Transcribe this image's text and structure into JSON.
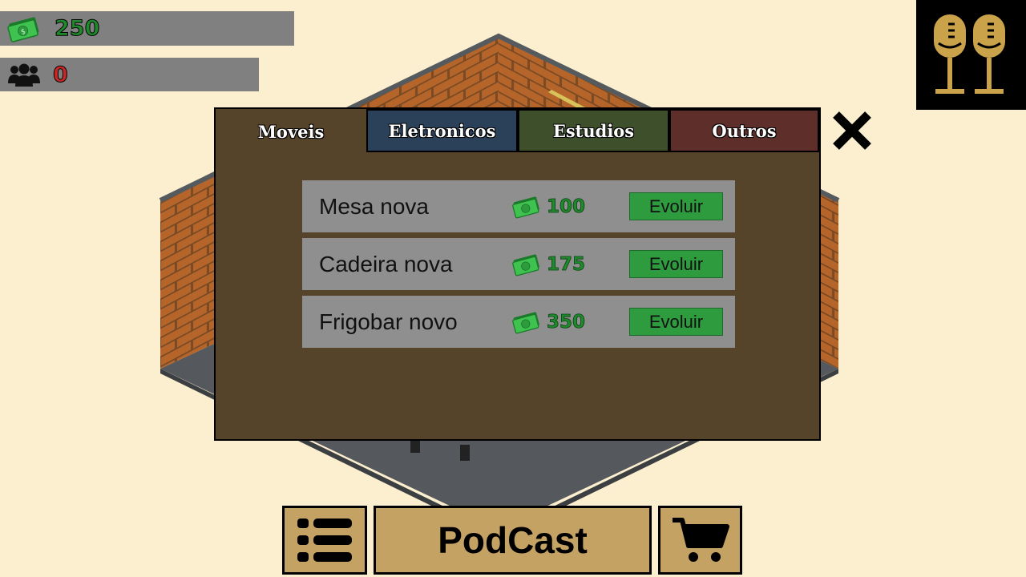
{
  "hud": {
    "money": "250",
    "listeners": "0"
  },
  "modal": {
    "tabs": [
      {
        "label": "Moveis",
        "color": "#55432a"
      },
      {
        "label": "Eletronicos",
        "color": "#2b4159"
      },
      {
        "label": "Estudios",
        "color": "#3e4f2c"
      },
      {
        "label": "Outros",
        "color": "#5e2e2a"
      }
    ],
    "items": [
      {
        "name": "Mesa nova",
        "price": "100",
        "button": "Evoluir"
      },
      {
        "name": "Cadeira nova",
        "price": "175",
        "button": "Evoluir"
      },
      {
        "name": "Frigobar novo",
        "price": "350",
        "button": "Evoluir"
      }
    ]
  },
  "bottom": {
    "podcast_label": "PodCast"
  },
  "icons": {
    "money": "money-icon",
    "listeners": "people-icon",
    "logo": "microphones-icon",
    "close": "close-icon",
    "menu": "list-icon",
    "shop": "cart-icon"
  },
  "colors": {
    "background": "#fcefd0",
    "money_green": "#1f8a2c",
    "listeners_red": "#c62828",
    "button_green": "#2e9b3e",
    "gold": "#c4a264",
    "logo_gold": "#c9a24a"
  }
}
